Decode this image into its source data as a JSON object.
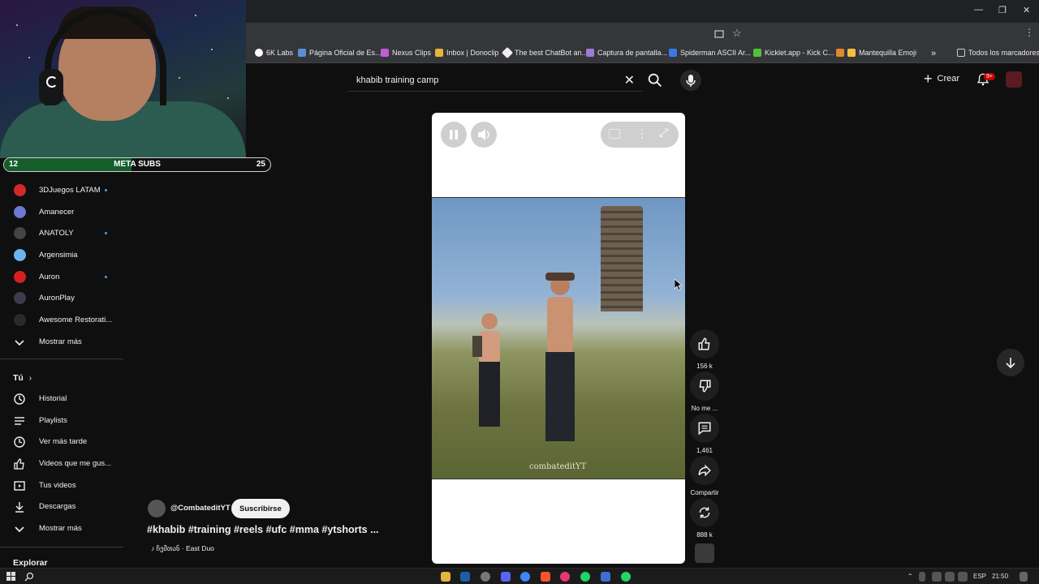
{
  "browser": {
    "bookmarks": [
      "6K Labs",
      "Página Oficial de Es...",
      "Nexus Clips",
      "Inbox | Donoclip",
      "The best ChatBot an...",
      "Captura de pantalla...",
      "Spiderman ASCII Ar...",
      "Kicklet.app - Kick C...",
      "Mantequilla Emoji"
    ],
    "all_bookmarks": "Todos los marcadores",
    "more_bookmarks": "»"
  },
  "header": {
    "search_query": "khabib training camp",
    "create_label": "Crear",
    "notification_badge": "9+"
  },
  "overlay": {
    "meta_left": "12",
    "meta_label": "META SUBS",
    "meta_right": "25",
    "meta_progress": 0.48
  },
  "sidebar": {
    "subscriptions": [
      {
        "label": "3DJuegos LATAM",
        "color": "#d12a2a",
        "dot": true
      },
      {
        "label": "Amanecer",
        "color": "#6a7bd1",
        "dot": false
      },
      {
        "label": "ANATOLY",
        "color": "#444444",
        "dot": true
      },
      {
        "label": "Argensimia",
        "color": "#6cb4ee",
        "dot": false
      },
      {
        "label": "Auron",
        "color": "#d61f1f",
        "dot": true
      },
      {
        "label": "AuronPlay",
        "color": "#3c3c4c",
        "dot": false
      },
      {
        "label": "Awesome Restorati...",
        "color": "#2a2a2a",
        "dot": false
      }
    ],
    "show_more_1": "Mostrar más",
    "you_heading": "Tú",
    "you_items": [
      "Historial",
      "Playlists",
      "Ver más tarde",
      "Videos que me gus...",
      "Tus videos",
      "Descargas"
    ],
    "show_more_2": "Mostrar más",
    "explore_heading": "Explorar"
  },
  "short": {
    "watermark": "combateditYT",
    "channel": "@CombateditYT",
    "subscribe_label": "Suscribirse",
    "title": "#khabib #training #reels #ufc #mma #ytshorts ...",
    "music": "ჩემთან · East Duo",
    "actions": {
      "like_count": "156 k",
      "dislike_label": "No me ...",
      "comment_count": "1,461",
      "share_label": "Compartir",
      "remix_count": "888 k"
    }
  },
  "taskbar": {
    "lang": "ESP",
    "time": "21:50"
  }
}
